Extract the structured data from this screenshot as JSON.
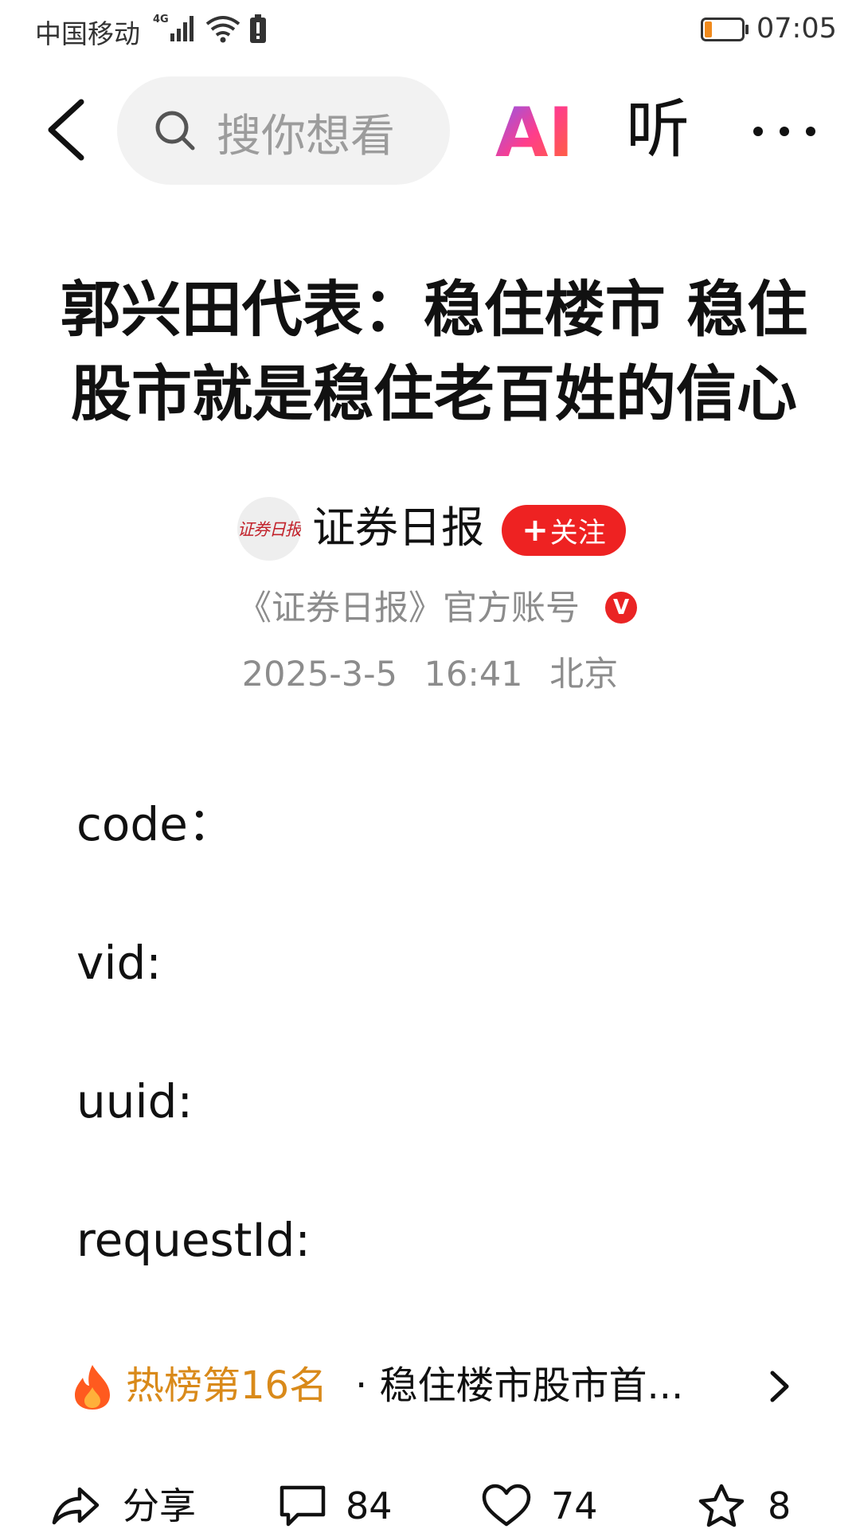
{
  "status_bar": {
    "carrier": "中国移动",
    "network": "4G",
    "time": "07:05",
    "battery_level": 0.2
  },
  "nav": {
    "search_placeholder": "搜你想看",
    "ai_label": "AI",
    "listen_label": "听"
  },
  "article": {
    "title": "郭兴田代表：稳住楼市 稳住股市就是稳住老百姓的信心",
    "author": {
      "avatar_text": "证券日报",
      "name": "证券日报",
      "follow_label": "关注",
      "official": "《证券日报》官方账号",
      "verified_mark": "V"
    },
    "date": "2025-3-5",
    "time": "16:41",
    "location": "北京",
    "fields": [
      "code：",
      "vid:",
      "uuid:",
      "requestId:"
    ]
  },
  "hot": {
    "rank_label": "热榜第16名",
    "description": "· 稳住楼市股市首..."
  },
  "bottom_bar": {
    "share_label": "分享",
    "comment_count": "84",
    "like_count": "74",
    "favorite_count": "8"
  },
  "colors": {
    "accent_red": "#ee2222",
    "hot_orange": "#d98a1a",
    "muted_gray": "#8c8c8c"
  }
}
